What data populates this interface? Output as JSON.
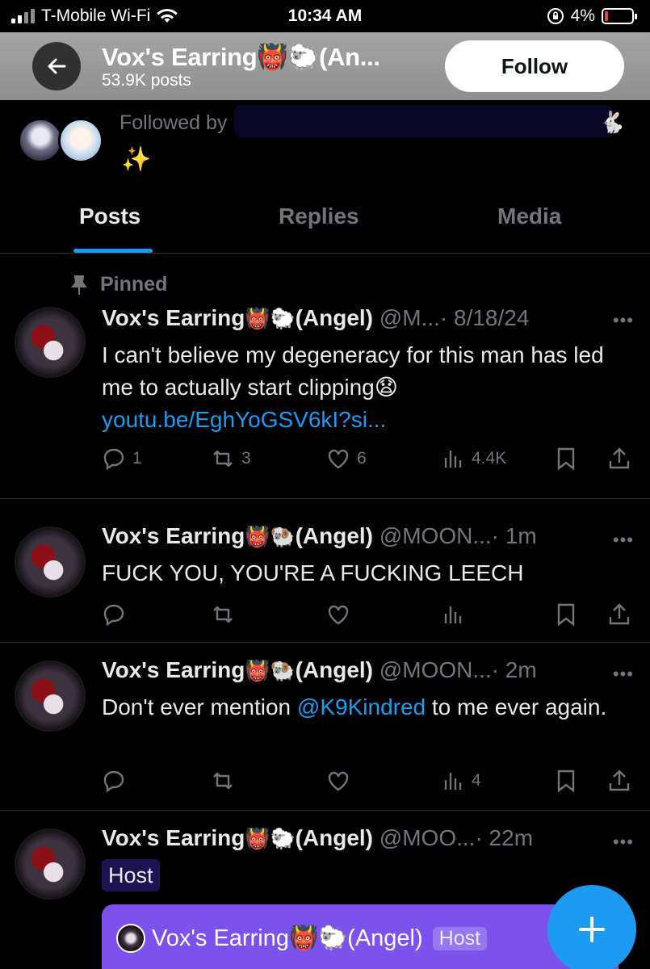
{
  "status_bar": {
    "carrier": "T-Mobile Wi-Fi",
    "time": "10:34 AM",
    "battery": "4%"
  },
  "header": {
    "title": "Vox's Earring👹🐑(An...",
    "subtitle": "53.9K posts",
    "follow_label": "Follow"
  },
  "followed_by": {
    "label": "Followed by",
    "sparkle": "✨"
  },
  "tabs": [
    {
      "label": "Posts",
      "active": true
    },
    {
      "label": "Replies",
      "active": false
    },
    {
      "label": "Media",
      "active": false
    }
  ],
  "pinned_label": "Pinned",
  "posts": [
    {
      "name": "Vox's Earring",
      "emoji": "👹🐑",
      "tag": "(Angel)",
      "handle": "@M...",
      "time": "· 8/18/24",
      "text": "I can't believe my degeneracy for this man has led me to actually start clipping😧",
      "link": "youtu.be/EghYoGSV6kI?si...",
      "replies": "1",
      "reposts": "3",
      "likes": "6",
      "views": "4.4K"
    },
    {
      "name": "Vox's Earring",
      "emoji": "👹🐏",
      "tag": "(Angel)",
      "handle": "@MOON...",
      "time": "· 1m",
      "text": "FUCK YOU, YOU'RE A FUCKING LEECH"
    },
    {
      "name": "Vox's Earring",
      "emoji": "👹🐏",
      "tag": "(Angel)",
      "handle": "@MOON...",
      "time": "· 2m",
      "text_before": "Don't ever mention ",
      "mention": "@K9Kindred",
      "text_after": " to me ever again.",
      "views": "4"
    },
    {
      "name": "Vox's Earring",
      "emoji": "👹🐑",
      "tag": "(Angel)",
      "handle": "@MOO...",
      "time": "· 22m",
      "badge": "Host"
    }
  ],
  "space_bar": {
    "name": "Vox's Earring👹🐑(Angel)",
    "host": "Host"
  },
  "more_glyph": "•••",
  "colors": {
    "accent": "#1d9bf0",
    "space_purple": "#7b53ec",
    "muted": "#71767b"
  }
}
